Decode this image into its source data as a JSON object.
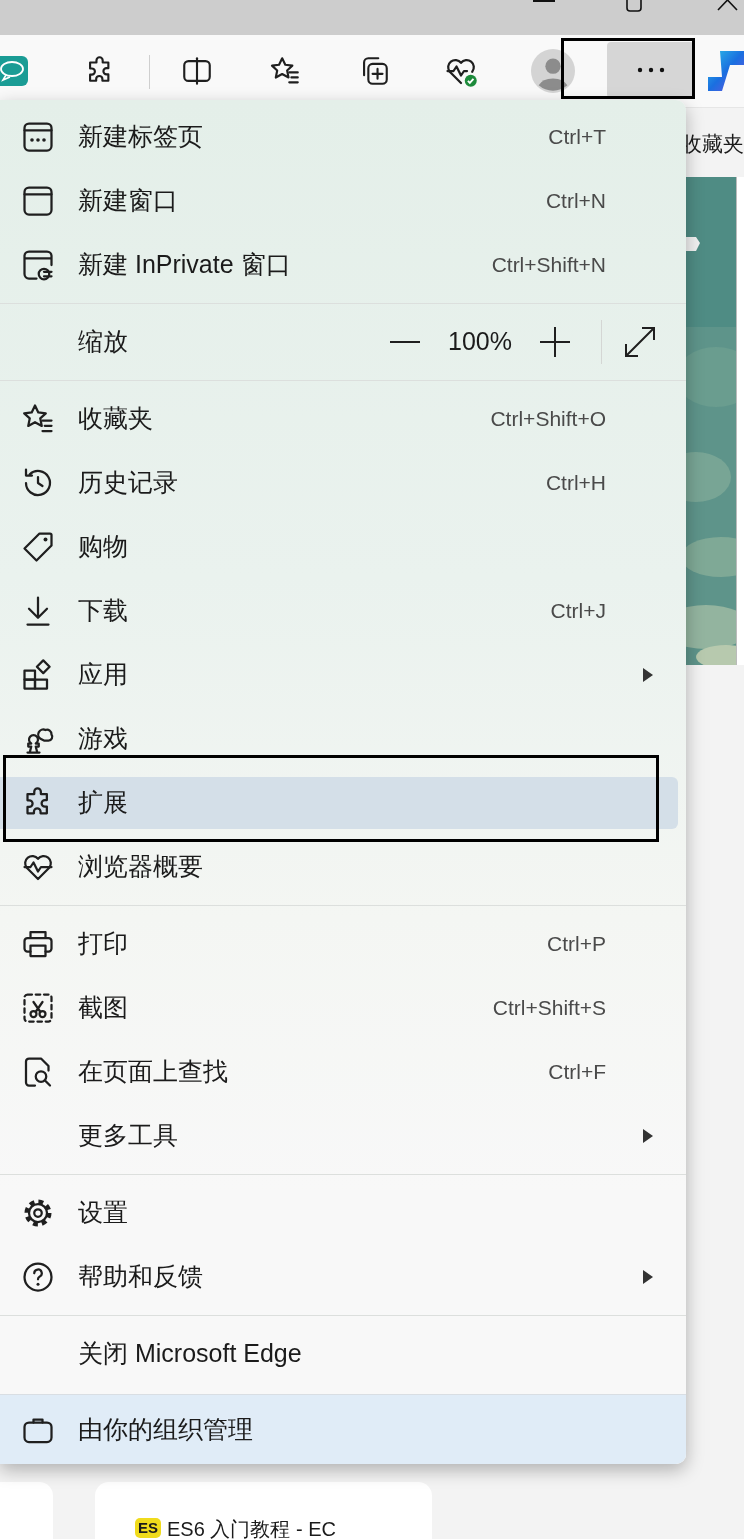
{
  "toolbar": {
    "more_button": {
      "pressed": true,
      "annotated": true
    }
  },
  "background": {
    "favorites_label": "收藏夹",
    "tab_card": {
      "badge": "ES",
      "title": "ES6 入门教程 - EC"
    }
  },
  "menu": {
    "sections": [
      {
        "kind": "items",
        "items": [
          {
            "label": "新建标签页",
            "shortcut": "Ctrl+T",
            "submenu": false,
            "selected": false,
            "annotated": false
          },
          {
            "label": "新建窗口",
            "shortcut": "Ctrl+N",
            "submenu": false,
            "selected": false,
            "annotated": false
          },
          {
            "label": "新建 InPrivate 窗口",
            "shortcut": "Ctrl+Shift+N",
            "submenu": false,
            "selected": false,
            "annotated": false
          }
        ]
      },
      {
        "kind": "zoom",
        "label": "缩放",
        "value": "100%"
      },
      {
        "kind": "items",
        "items": [
          {
            "label": "收藏夹",
            "shortcut": "Ctrl+Shift+O",
            "submenu": false,
            "selected": false,
            "annotated": false
          },
          {
            "label": "历史记录",
            "shortcut": "Ctrl+H",
            "submenu": false,
            "selected": false,
            "annotated": false
          },
          {
            "label": "购物",
            "submenu": false,
            "selected": false,
            "annotated": false
          },
          {
            "label": "下载",
            "shortcut": "Ctrl+J",
            "submenu": false,
            "selected": false,
            "annotated": false
          },
          {
            "label": "应用",
            "submenu": true,
            "selected": false,
            "annotated": false
          },
          {
            "label": "游戏",
            "submenu": false,
            "selected": false,
            "annotated": false
          },
          {
            "label": "扩展",
            "submenu": false,
            "selected": true,
            "annotated": true
          },
          {
            "label": "浏览器概要",
            "submenu": false,
            "selected": false,
            "annotated": false
          }
        ]
      },
      {
        "kind": "items",
        "items": [
          {
            "label": "打印",
            "shortcut": "Ctrl+P",
            "submenu": false,
            "selected": false,
            "annotated": false
          },
          {
            "label": "截图",
            "shortcut": "Ctrl+Shift+S",
            "submenu": false,
            "selected": false,
            "annotated": false
          },
          {
            "label": "在页面上查找",
            "shortcut": "Ctrl+F",
            "submenu": false,
            "selected": false,
            "annotated": false
          },
          {
            "label": "更多工具",
            "submenu": true,
            "selected": false,
            "annotated": false
          }
        ]
      },
      {
        "kind": "items",
        "items": [
          {
            "label": "设置",
            "submenu": false,
            "selected": false,
            "annotated": false
          },
          {
            "label": "帮助和反馈",
            "submenu": true,
            "selected": false,
            "annotated": false
          }
        ]
      },
      {
        "kind": "items",
        "items": [
          {
            "label": "关闭 Microsoft Edge",
            "submenu": false,
            "selected": false,
            "annotated": false
          }
        ]
      }
    ],
    "footer": {
      "label": "由你的组织管理"
    }
  }
}
